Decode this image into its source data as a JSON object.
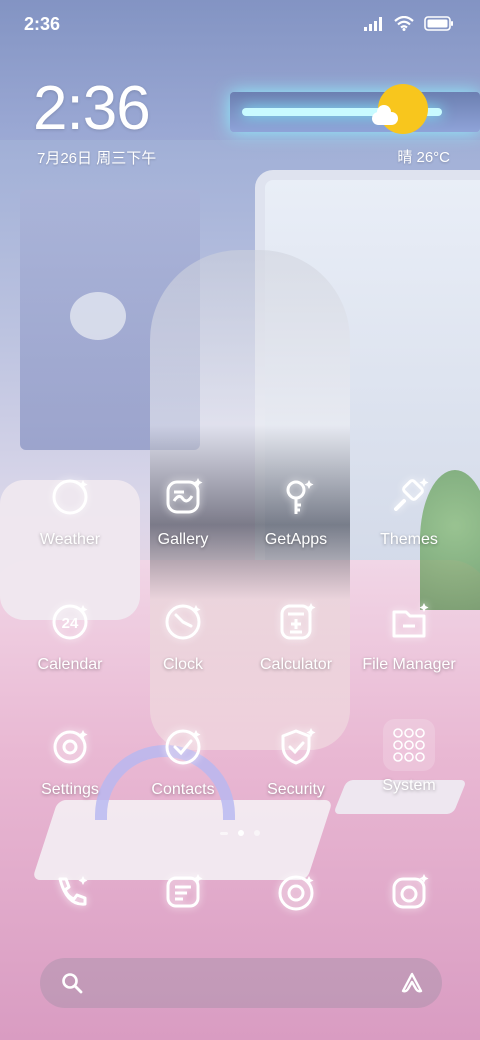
{
  "status_bar": {
    "time": "2:36",
    "icons": [
      "signal-icon",
      "wifi-icon",
      "battery-icon"
    ]
  },
  "clock_widget": {
    "time": "2:36",
    "date": "7月26日 周三下午"
  },
  "weather_widget": {
    "icon": "partly-sunny-icon",
    "text": "晴 26°C"
  },
  "home_apps": [
    {
      "label": "Weather",
      "icon": "weather-icon"
    },
    {
      "label": "Gallery",
      "icon": "gallery-icon"
    },
    {
      "label": "GetApps",
      "icon": "getapps-icon"
    },
    {
      "label": "Themes",
      "icon": "themes-brush-icon"
    },
    {
      "label": "Calendar",
      "icon": "calendar-icon",
      "badge": "24"
    },
    {
      "label": "Clock",
      "icon": "clock-icon"
    },
    {
      "label": "Calculator",
      "icon": "calculator-icon"
    },
    {
      "label": "File Manager",
      "icon": "folder-icon"
    },
    {
      "label": "Settings",
      "icon": "settings-gear-icon"
    },
    {
      "label": "Contacts",
      "icon": "contacts-icon"
    },
    {
      "label": "Security",
      "icon": "shield-icon"
    },
    {
      "label": "System",
      "icon": "system-folder-icon"
    }
  ],
  "pages": {
    "count": 2,
    "current": 1
  },
  "dock": [
    {
      "icon": "phone-icon"
    },
    {
      "icon": "messages-icon"
    },
    {
      "icon": "browser-icon"
    },
    {
      "icon": "camera-icon"
    }
  ],
  "search_bar": {
    "left_icon": "search-icon",
    "right_icon": "assistant-icon"
  },
  "colors": {
    "weather_sun": "#f8c61d",
    "icon_stroke": "#ffffff"
  }
}
